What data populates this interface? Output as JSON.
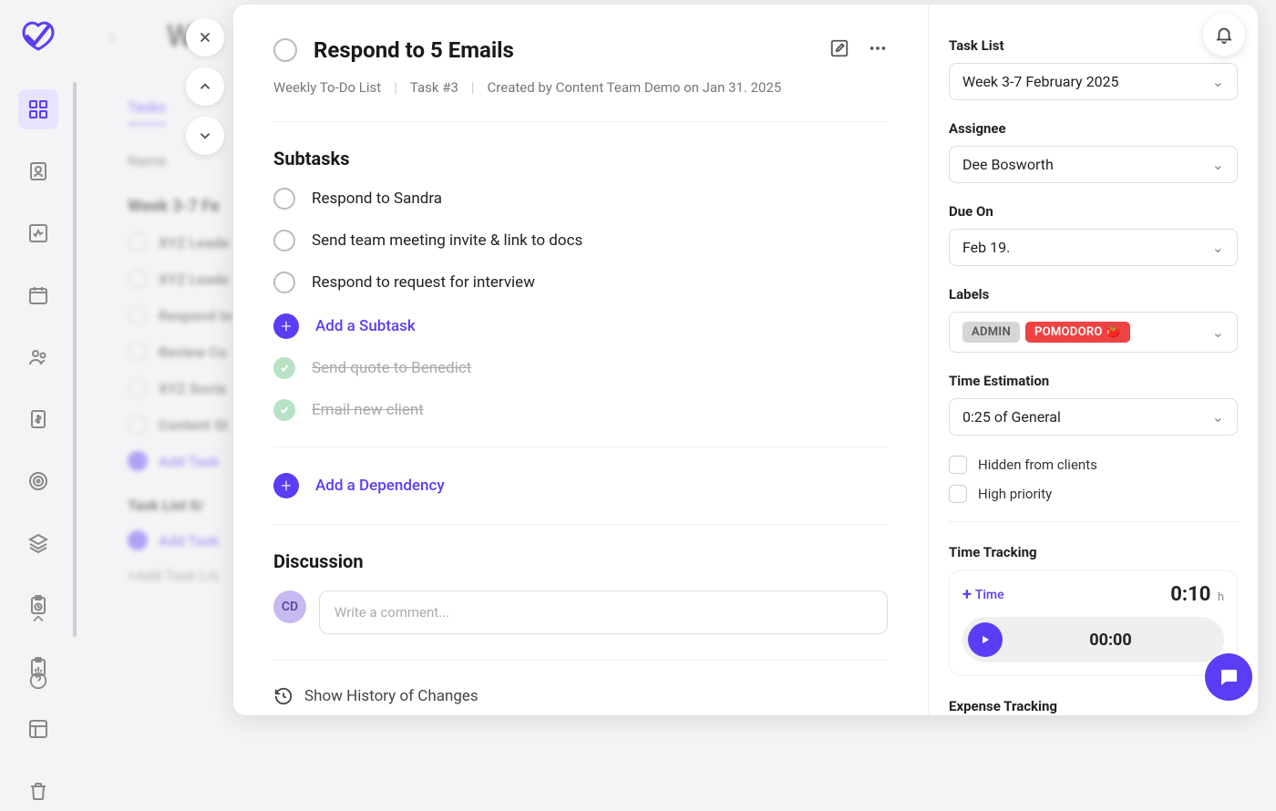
{
  "background": {
    "page_title": "We",
    "tab_label": "Tasks",
    "name_header": "Name",
    "group": "Week 3-7 Fe",
    "rows": [
      "XYZ Leade",
      "XYZ Leade",
      "Respond to",
      "Review Co",
      "XYZ Socia",
      "Content St"
    ],
    "add_task": "Add Task",
    "tasklist_header": "Task List   0/",
    "add_task2": "Add Task",
    "add_tasklist": "+Add Task Lis"
  },
  "task": {
    "title": "Respond to 5 Emails",
    "breadcrumb_list": "Weekly To-Do List",
    "task_number": "Task #3",
    "created": "Created by Content Team Demo on Jan 31. 2025"
  },
  "subtasks": {
    "heading": "Subtasks",
    "open": [
      "Respond to Sandra",
      "Send team meeting invite & link to docs",
      "Respond to request for interview"
    ],
    "add_label": "Add a Subtask",
    "done": [
      "Send quote to Benedict",
      "Email new client"
    ]
  },
  "dependency": {
    "add_label": "Add a Dependency"
  },
  "discussion": {
    "heading": "Discussion",
    "avatar": "CD",
    "placeholder": "Write a comment..."
  },
  "history": {
    "label": "Show History of Changes"
  },
  "side": {
    "task_list": {
      "label": "Task List",
      "value": "Week 3-7 February 2025"
    },
    "assignee": {
      "label": "Assignee",
      "value": "Dee Bosworth"
    },
    "due": {
      "label": "Due On",
      "value": "Feb 19."
    },
    "labels": {
      "label": "Labels",
      "admin": "ADMIN",
      "pomodoro": "POMODORO 🍅"
    },
    "time_est": {
      "label": "Time Estimation",
      "value": "0:25 of General"
    },
    "hidden": "Hidden from clients",
    "priority": "High priority",
    "time_tracking": {
      "label": "Time Tracking",
      "add": "Time",
      "value": "0:10",
      "unit": "h",
      "timer": "00:00"
    },
    "expense": {
      "label": "Expense Tracking"
    }
  }
}
